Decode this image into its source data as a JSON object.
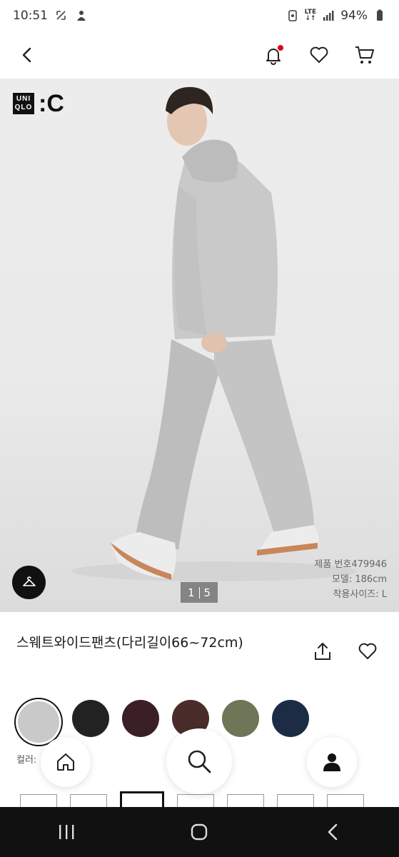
{
  "status_bar": {
    "time": "10:51",
    "battery": "94%",
    "network_top": "LTE",
    "network_bottom": "↓↑"
  },
  "header": {
    "back_icon": "back-chevron-icon",
    "notification_icon": "bell-icon",
    "notification_dot_color": "#e60012",
    "wishlist_icon": "heart-icon",
    "cart_icon": "cart-icon"
  },
  "hero": {
    "brand_box_line1": "UNI",
    "brand_box_line2": "QLO",
    "brand_suffix": ":C",
    "pager_current": "1",
    "pager_total": "5",
    "product_number": "제품 번호479946",
    "model_height": "모델: 186cm",
    "model_size": "착용사이즈: L",
    "hanger_icon": "hanger-icon"
  },
  "product": {
    "title": "스웨트와이드팬츠(다리길이66~72cm)",
    "share_icon": "share-icon",
    "favorite_icon": "heart-icon"
  },
  "colors": {
    "label": "컬러:",
    "swatches": [
      {
        "color": "#c9c9c9",
        "selected": true
      },
      {
        "color": "#222222",
        "selected": false
      },
      {
        "color": "#3a1f24",
        "selected": false
      },
      {
        "color": "#4a2c2a",
        "selected": false
      },
      {
        "color": "#6f7657",
        "selected": false
      },
      {
        "color": "#1c2c45",
        "selected": false
      }
    ]
  },
  "bottom_nav": {
    "home_icon": "home-icon",
    "search_icon": "search-icon",
    "user_icon": "user-icon"
  },
  "system_nav": {
    "recents_icon": "recents-icon",
    "home_icon": "home-circle-icon",
    "back_icon": "back-icon"
  }
}
